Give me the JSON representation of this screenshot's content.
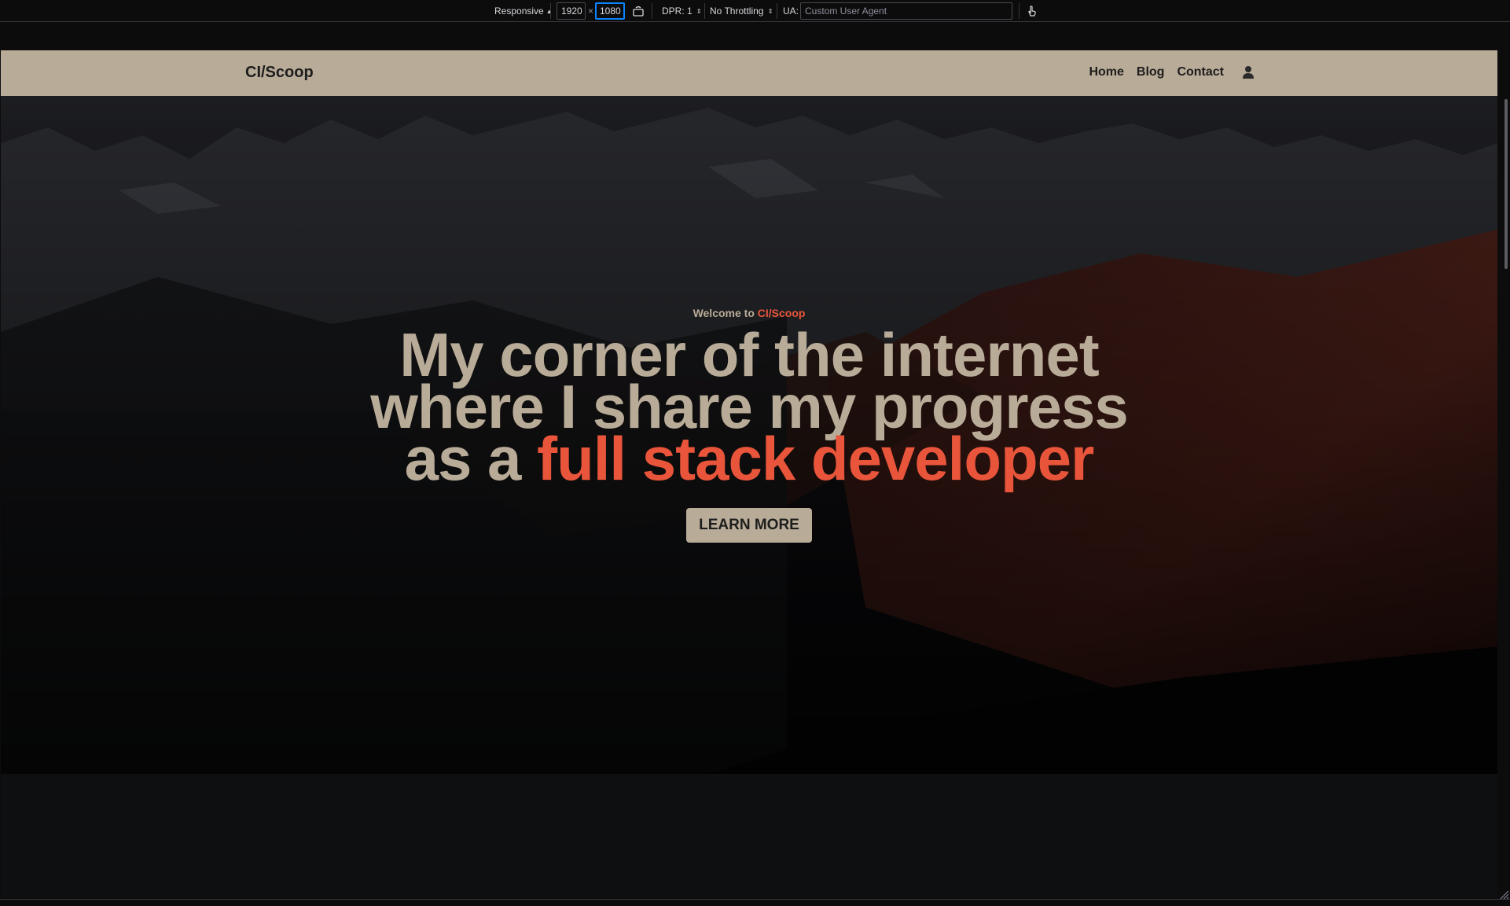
{
  "rdm": {
    "device": "Responsive",
    "width": "1920",
    "height": "1080",
    "dpr": "DPR: 1",
    "throttling": "No Throttling",
    "ua_label": "UA:",
    "ua_placeholder": "Custom User Agent"
  },
  "site": {
    "brand": "CI/Scoop",
    "nav": [
      {
        "label": "Home"
      },
      {
        "label": "Blog"
      },
      {
        "label": "Contact"
      }
    ]
  },
  "hero": {
    "welcome_prefix": "Welcome to ",
    "welcome_brand": "CI/Scoop",
    "headline_line1": "My corner of the internet",
    "headline_line2": "where I share my progress",
    "headline_line3_prefix": "as a ",
    "headline_line3_accent": "full stack developer",
    "cta": "LEARN MORE"
  },
  "colors": {
    "navbar": "#b8ab97",
    "accent": "#e8553a",
    "hero_text": "#b8ab97",
    "toolbar_bg": "#0c0c0d",
    "focus_ring": "#0a84ff"
  }
}
